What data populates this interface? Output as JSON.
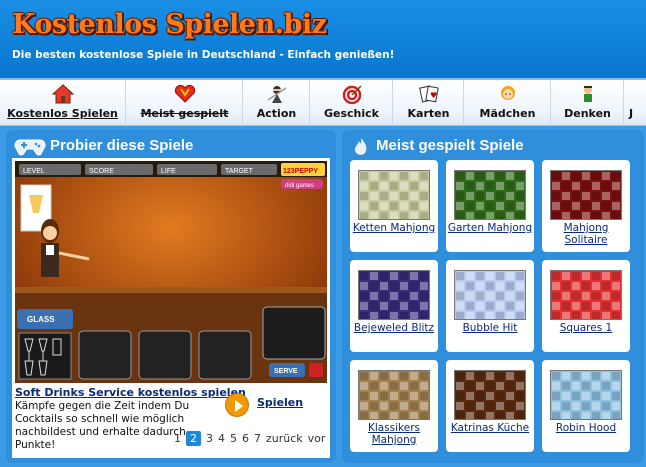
{
  "header": {
    "logo_text": "Kostenlos Spielen.biz",
    "tagline": "Die besten kostenlose Spiele in Deutschland - Einfach genießen!"
  },
  "nav": {
    "items": [
      {
        "label": "Kostenlos Spielen",
        "icon": "house-icon"
      },
      {
        "label": "Meist gespielt",
        "icon": "heart-icon"
      },
      {
        "label": "Action",
        "icon": "ninja-icon"
      },
      {
        "label": "Geschick",
        "icon": "target-icon"
      },
      {
        "label": "Karten",
        "icon": "cards-icon"
      },
      {
        "label": "Mädchen",
        "icon": "girl-icon"
      },
      {
        "label": "Denken",
        "icon": "thinker-icon"
      },
      {
        "label": "J",
        "icon": "joystick-icon"
      }
    ]
  },
  "left_panel": {
    "title": "Probier diese Spiele",
    "icon": "gamepad-icon",
    "game": {
      "title": "Soft Drinks Service kostenlos spielen",
      "description": "Kämpfe gegen die Zeit indem Du Cocktails so schnell wie möglich nachbildest und erhalte dadurch Punkte!",
      "play_label": "Spielen",
      "hud": {
        "level": "LEVEL",
        "score": "SCORE",
        "life": "LIFE",
        "target": "TARGET",
        "brand": "123PEPPY",
        "glass": "GLASS",
        "serve": "SERVE",
        "site": "didi games"
      }
    },
    "pager": {
      "pages": [
        "1",
        "2",
        "3",
        "4",
        "5",
        "6",
        "7"
      ],
      "current": "2",
      "back": "zurück",
      "forward": "vor"
    }
  },
  "right_panel": {
    "title": "Meist gespielt Spiele",
    "icon": "flame-icon",
    "games": [
      {
        "name": "Ketten Mahjong",
        "thumb_color": "#c9c9a0"
      },
      {
        "name": "Garten Mahjong",
        "thumb_color": "#2f6a1a"
      },
      {
        "name": "Mahjong Solitaire",
        "thumb_color": "#7a1010"
      },
      {
        "name": "Bejeweled Blitz",
        "thumb_color": "#3a2a7a"
      },
      {
        "name": "Bubble Hit",
        "thumb_color": "#b9c9f0"
      },
      {
        "name": "Squares 1",
        "thumb_color": "#e03030"
      },
      {
        "name": "Klassikers Mahjong",
        "thumb_color": "#a08050"
      },
      {
        "name": "Katrinas Küche",
        "thumb_color": "#5a2a10"
      },
      {
        "name": "Robin Hood",
        "thumb_color": "#8fc0e0"
      }
    ]
  }
}
